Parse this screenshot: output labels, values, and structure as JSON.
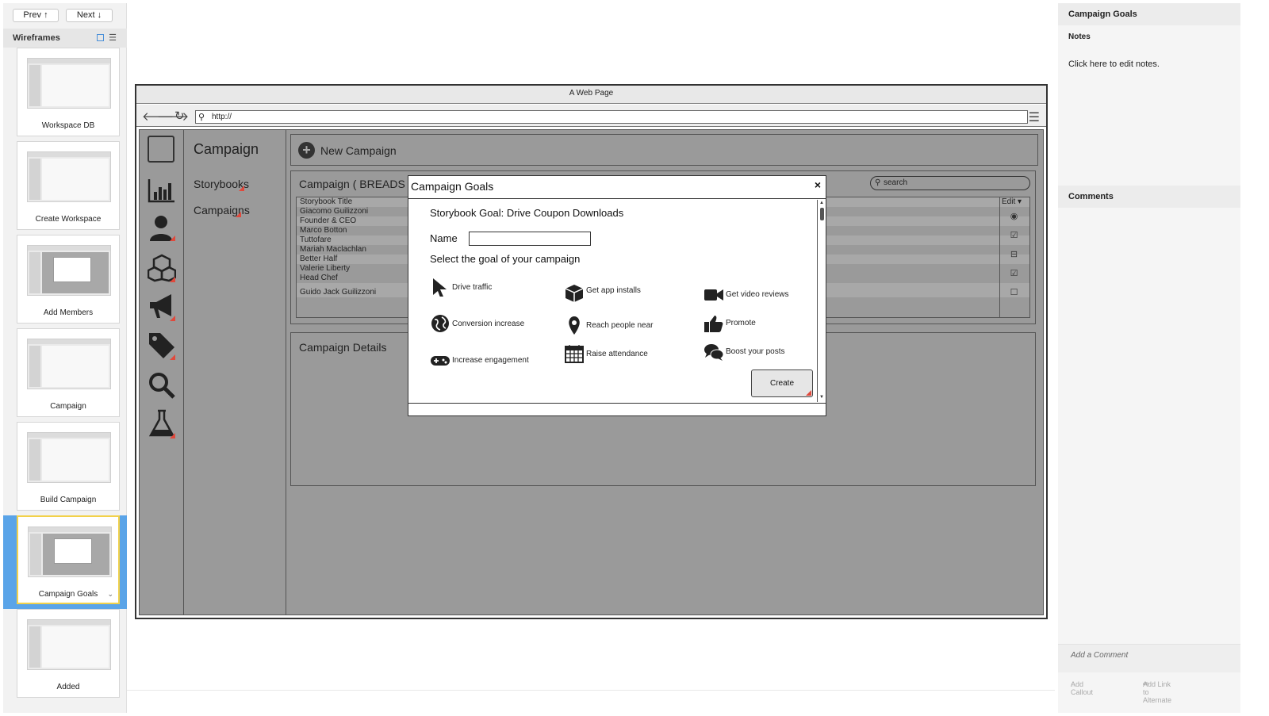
{
  "left_panel": {
    "prev_label": "Prev ↑",
    "next_label": "Next ↓",
    "header": "Wireframes",
    "thumbnails": [
      {
        "label": "Workspace DB"
      },
      {
        "label": "Create Workspace"
      },
      {
        "label": "Add Members"
      },
      {
        "label": "Campaign"
      },
      {
        "label": "Build Campaign"
      },
      {
        "label": "Campaign Goals",
        "selected": true
      },
      {
        "label": "Added"
      }
    ]
  },
  "right_panel": {
    "title": "Campaign Goals",
    "notes_label": "Notes",
    "notes_placeholder": "Click here to edit notes.",
    "comments_label": "Comments",
    "add_comment": "Add a Comment",
    "add_callout": "Add Callout",
    "add_link": "Add Link to Alternate"
  },
  "browser": {
    "title": "A Web Page",
    "url": "http://"
  },
  "app": {
    "nav_title": "Campaign",
    "nav_items": [
      "Storybooks",
      "Campaigns"
    ],
    "new_campaign": "New Campaign",
    "table_title": "Campaign ( BREADS )",
    "search_placeholder": "search",
    "edit_header": "Edit",
    "rows": [
      "Storybook Title",
      "Giacomo Guilizzoni",
      "Founder & CEO",
      "Marco Botton",
      "Tuttofare",
      "Mariah Maclachlan",
      "Better Half",
      "Valerie Liberty",
      "Head Chef",
      "Guido Jack Guilizzoni"
    ],
    "details_title": "Campaign Details"
  },
  "dialog": {
    "title": "Campaign Goals",
    "close": "×",
    "goal_title": "Storybook Goal: Drive Coupon Downloads",
    "name_label": "Name",
    "select_label": "Select the goal of your campaign",
    "goals": [
      "Drive traffic",
      "Get app installs",
      "Get video reviews",
      "Conversion increase",
      "Reach people near",
      "Promote",
      "Increase engagement",
      "Raise attendance",
      "Boost your posts"
    ],
    "create_label": "Create"
  }
}
